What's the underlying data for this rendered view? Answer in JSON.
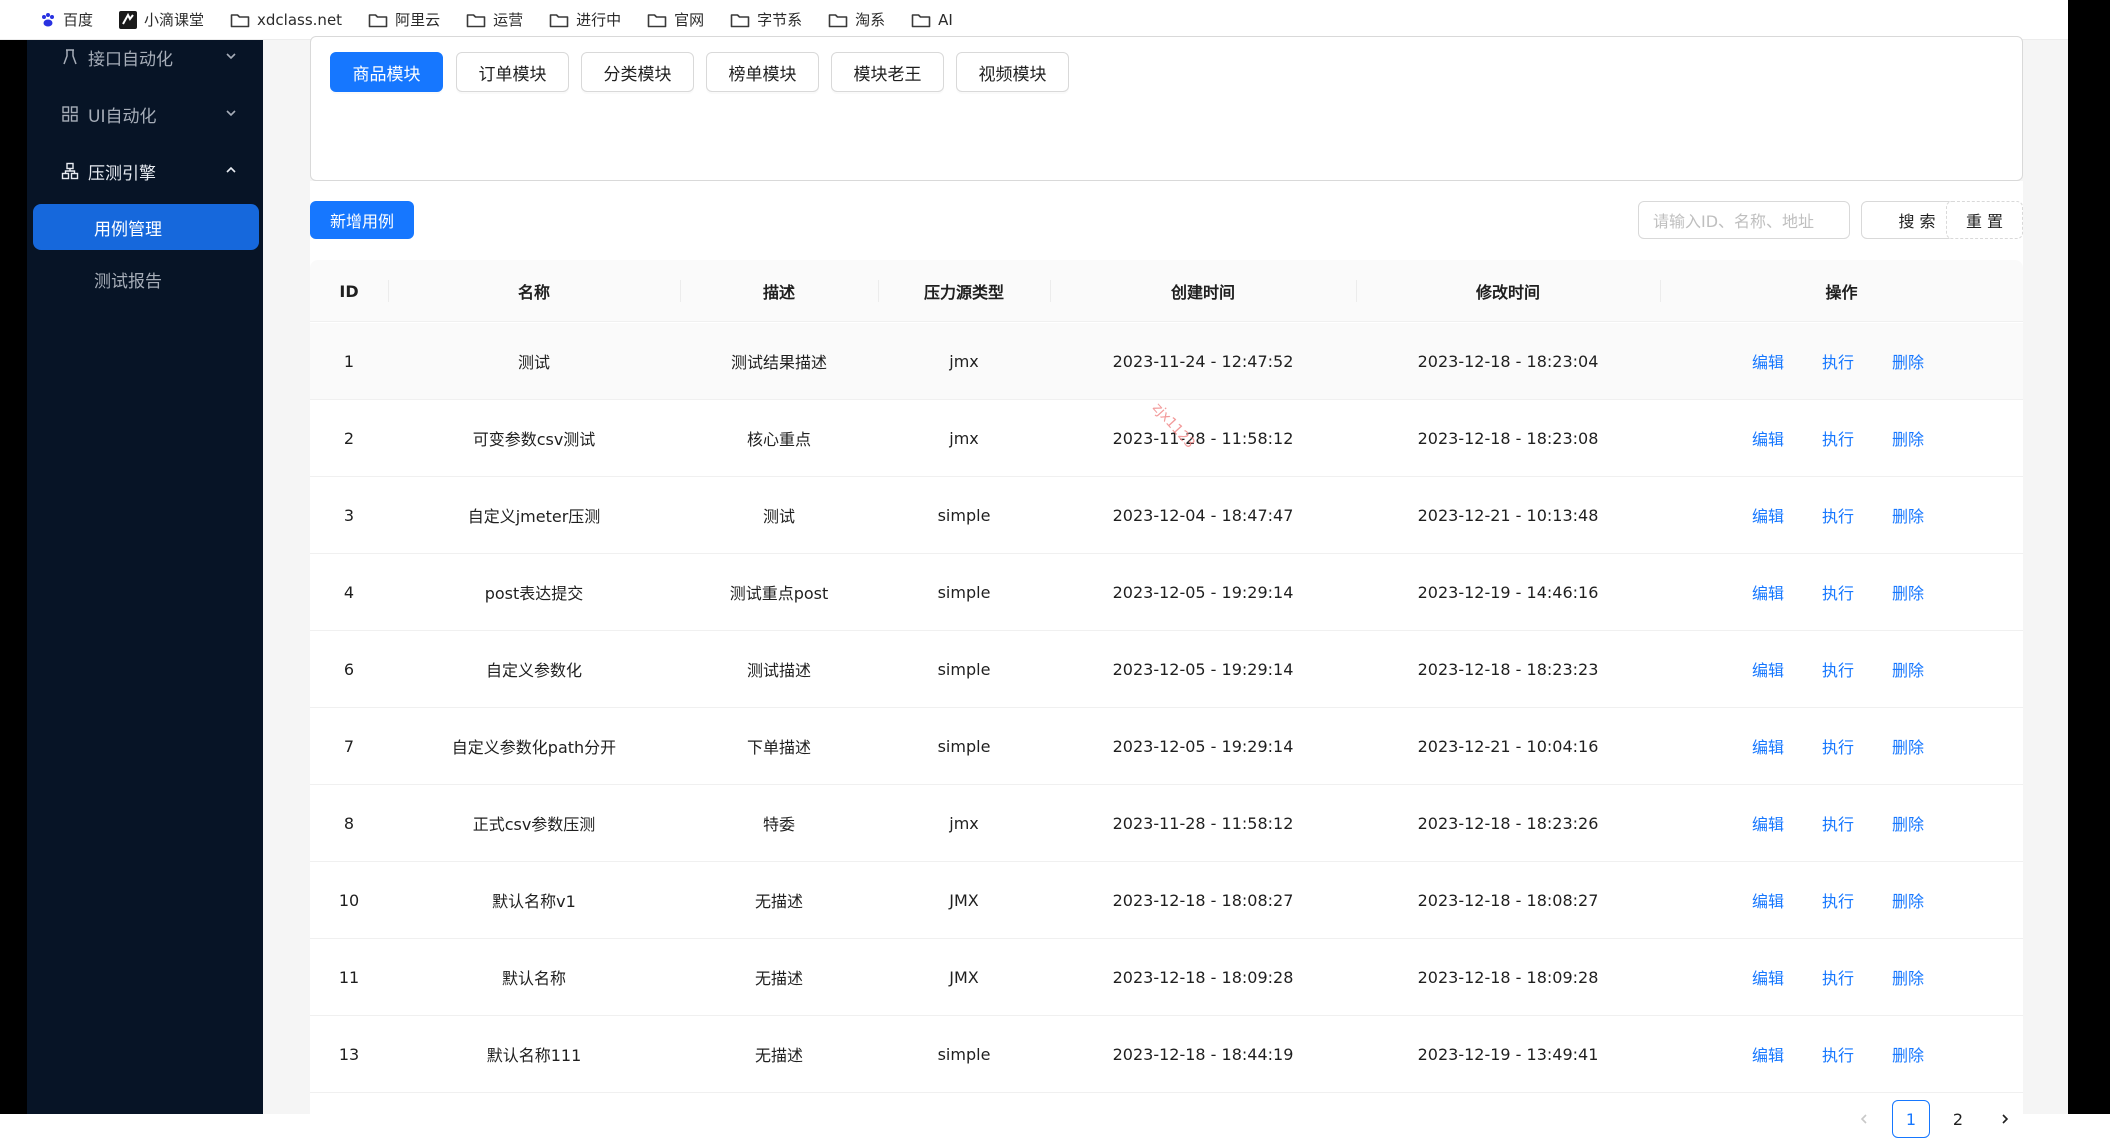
{
  "bookmarks": [
    {
      "label": "百度",
      "icon": "baidu-paw-icon"
    },
    {
      "label": "小滴课堂",
      "icon": "xd-logo-icon"
    },
    {
      "label": "xdclass.net",
      "icon": "folder-icon"
    },
    {
      "label": "阿里云",
      "icon": "folder-icon"
    },
    {
      "label": "运营",
      "icon": "folder-icon"
    },
    {
      "label": "进行中",
      "icon": "folder-icon"
    },
    {
      "label": "官网",
      "icon": "folder-icon"
    },
    {
      "label": "字节系",
      "icon": "folder-icon"
    },
    {
      "label": "淘系",
      "icon": "folder-icon"
    },
    {
      "label": "AI",
      "icon": "folder-icon"
    }
  ],
  "sidebar": {
    "menus": [
      {
        "label": "接口自动化",
        "icon": "api-automation-icon",
        "expanded": false
      },
      {
        "label": "UI自动化",
        "icon": "grid-icon",
        "expanded": false
      },
      {
        "label": "压测引擎",
        "icon": "cluster-icon",
        "expanded": true
      }
    ],
    "sub_items": [
      {
        "label": "用例管理",
        "active": true
      },
      {
        "label": "测试报告",
        "active": false
      }
    ]
  },
  "modules": {
    "tabs": [
      {
        "label": "商品模块",
        "active": true
      },
      {
        "label": "订单模块",
        "active": false
      },
      {
        "label": "分类模块",
        "active": false
      },
      {
        "label": "榜单模块",
        "active": false
      },
      {
        "label": "模块老王",
        "active": false
      },
      {
        "label": "视频模块",
        "active": false
      }
    ]
  },
  "toolbar": {
    "add_label": "新增用例",
    "search_placeholder": "请输入ID、名称、地址",
    "search_label": "搜 索",
    "reset_label": "重 置"
  },
  "table": {
    "columns": [
      "ID",
      "名称",
      "描述",
      "压力源类型",
      "创建时间",
      "修改时间",
      "操作"
    ],
    "actions": [
      "编辑",
      "执行",
      "删除"
    ],
    "rows": [
      {
        "id": "1",
        "name": "测试",
        "desc": "测试结果描述",
        "type": "jmx",
        "created": "2023-11-24 - 12:47:52",
        "modified": "2023-12-18 - 18:23:04"
      },
      {
        "id": "2",
        "name": "可变参数csv测试",
        "desc": "核心重点",
        "type": "jmx",
        "created": "2023-11-28 - 11:58:12",
        "modified": "2023-12-18 - 18:23:08"
      },
      {
        "id": "3",
        "name": "自定义jmeter压测",
        "desc": "测试",
        "type": "simple",
        "created": "2023-12-04 - 18:47:47",
        "modified": "2023-12-21 - 10:13:48"
      },
      {
        "id": "4",
        "name": "post表达提交",
        "desc": "测试重点post",
        "type": "simple",
        "created": "2023-12-05 - 19:29:14",
        "modified": "2023-12-19 - 14:46:16"
      },
      {
        "id": "6",
        "name": "自定义参数化",
        "desc": "测试描述",
        "type": "simple",
        "created": "2023-12-05 - 19:29:14",
        "modified": "2023-12-18 - 18:23:23"
      },
      {
        "id": "7",
        "name": "自定义参数化path分开",
        "desc": "下单描述",
        "type": "simple",
        "created": "2023-12-05 - 19:29:14",
        "modified": "2023-12-21 - 10:04:16"
      },
      {
        "id": "8",
        "name": "正式csv参数压测",
        "desc": "特委",
        "type": "jmx",
        "created": "2023-11-28 - 11:58:12",
        "modified": "2023-12-18 - 18:23:26"
      },
      {
        "id": "10",
        "name": "默认名称v1",
        "desc": "无描述",
        "type": "JMX",
        "created": "2023-12-18 - 18:08:27",
        "modified": "2023-12-18 - 18:08:27"
      },
      {
        "id": "11",
        "name": "默认名称",
        "desc": "无描述",
        "type": "JMX",
        "created": "2023-12-18 - 18:09:28",
        "modified": "2023-12-18 - 18:09:28"
      },
      {
        "id": "13",
        "name": "默认名称111",
        "desc": "无描述",
        "type": "simple",
        "created": "2023-12-18 - 18:44:19",
        "modified": "2023-12-19 - 13:49:41"
      }
    ]
  },
  "pagination": {
    "pages": [
      "1",
      "2"
    ],
    "current": "1"
  },
  "watermark": "zjx1123",
  "colors": {
    "primary": "#1677ff",
    "sidebar_bg": "#071426",
    "sidebar_active": "#1668dc"
  }
}
